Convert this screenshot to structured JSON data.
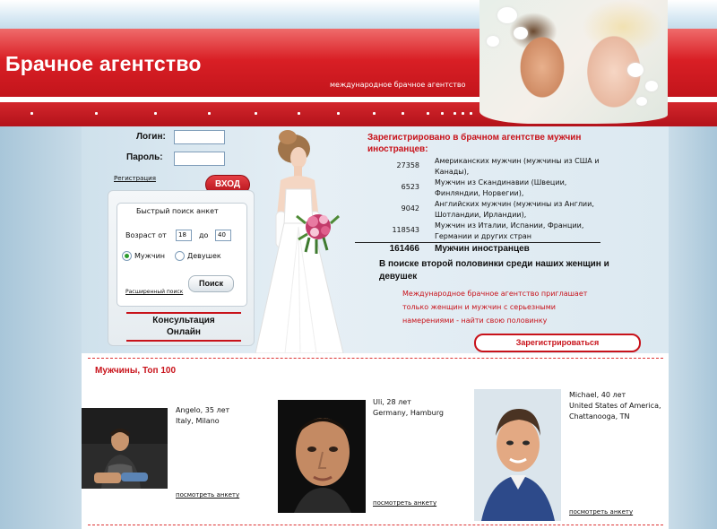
{
  "header": {
    "brand": "Брачное агентство",
    "tagline": "международное брачное агентство"
  },
  "login": {
    "login_label": "Логин:",
    "password_label": "Пароль:",
    "register_link": "Регистрация",
    "enter_button": "ВХОД"
  },
  "quick_search": {
    "title": "Быстрый поиск анкет",
    "age_from_label": "Возраст от",
    "age_from_value": "18",
    "age_to_label": "до",
    "age_to_value": "40",
    "men_label": "Мужчин",
    "women_label": "Девушек",
    "advanced_link": "Расширенный поиск",
    "search_button": "Поиск"
  },
  "consultation": {
    "line1": "Консультация",
    "line2": "Онлайн"
  },
  "stats": {
    "title": "Зарегистрировано в брачном агентстве мужчин иностранцев:",
    "rows": [
      {
        "count": "27358",
        "desc": "Американских мужчин (мужчины из США и Канады),"
      },
      {
        "count": "6523",
        "desc": "Мужчин из Скандинавии (Швеции, Финляндии, Норвегии),"
      },
      {
        "count": "9042",
        "desc": "Английских мужчин (мужчины из Англии, Шотландии, Ирландии),"
      },
      {
        "count": "118543",
        "desc": "Мужчин из Италии, Испании, Франции, Германии и других стран"
      }
    ],
    "total_count": "161466",
    "total_label": "Мужчин иностранцев",
    "search_info": "В поиске второй половинки среди наших женщин и девушек",
    "invite": "Международное брачное агентство приглашает только женщин и мужчин с серьезными намерениями - найти свою половинку",
    "register_button": "Зарегистрироваться"
  },
  "top100": {
    "title": "Мужчины, Топ 100",
    "view_profile": "посмотреть анкету",
    "profiles": [
      {
        "line1": "Angelo, 35 лет",
        "line2": "Italy, Milano"
      },
      {
        "line1": "Uli, 28 лет",
        "line2": "Germany, Hamburg"
      },
      {
        "line1": "Michael, 40 лет",
        "line2": "United States of America,",
        "line3": "Chattanooga, TN"
      }
    ]
  }
}
